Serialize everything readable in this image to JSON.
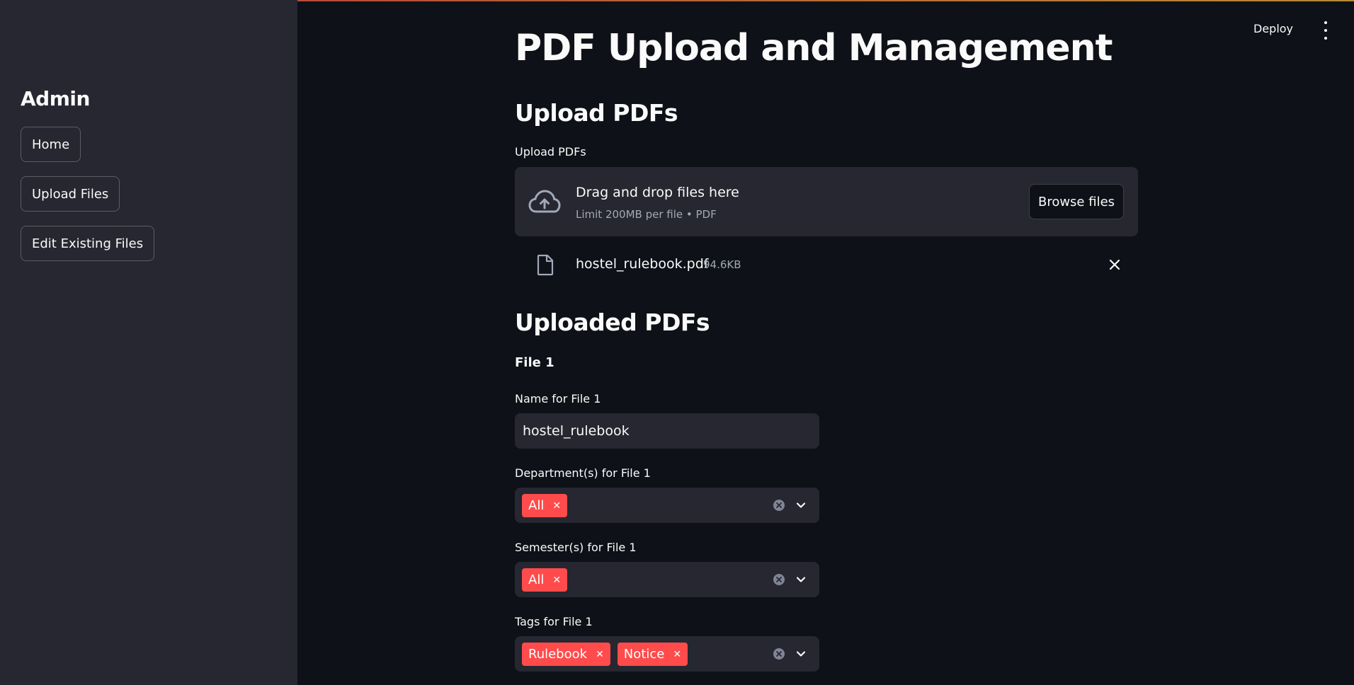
{
  "sidebar": {
    "title": "Admin",
    "items": [
      {
        "label": "Home"
      },
      {
        "label": "Upload Files"
      },
      {
        "label": "Edit Existing Files"
      }
    ]
  },
  "header": {
    "deploy_label": "Deploy",
    "menu_icon": "kebab-menu-icon"
  },
  "main": {
    "page_title": "PDF Upload and Management",
    "upload_section": {
      "heading": "Upload PDFs",
      "uploader_label": "Upload PDFs",
      "dropzone_title": "Drag and drop files here",
      "dropzone_subtitle": "Limit 200MB per file • PDF",
      "browse_label": "Browse files",
      "uploaded_file": {
        "name": "hostel_rulebook.pdf",
        "size": "94.6KB"
      }
    },
    "uploaded_section": {
      "heading": "Uploaded PDFs",
      "file_heading": "File 1",
      "name_label": "Name for File 1",
      "name_value": "hostel_rulebook",
      "department_label": "Department(s) for File 1",
      "department_chips": [
        {
          "label": "All"
        }
      ],
      "semester_label": "Semester(s) for File 1",
      "semester_chips": [
        {
          "label": "All"
        }
      ],
      "tags_label": "Tags for File 1",
      "tags_chips": [
        {
          "label": "Rulebook"
        },
        {
          "label": "Notice"
        }
      ]
    }
  },
  "colors": {
    "background": "#0e1117",
    "sidebar": "#262730",
    "accent": "#ff4b4b",
    "muted_text": "#a3a8b8"
  }
}
